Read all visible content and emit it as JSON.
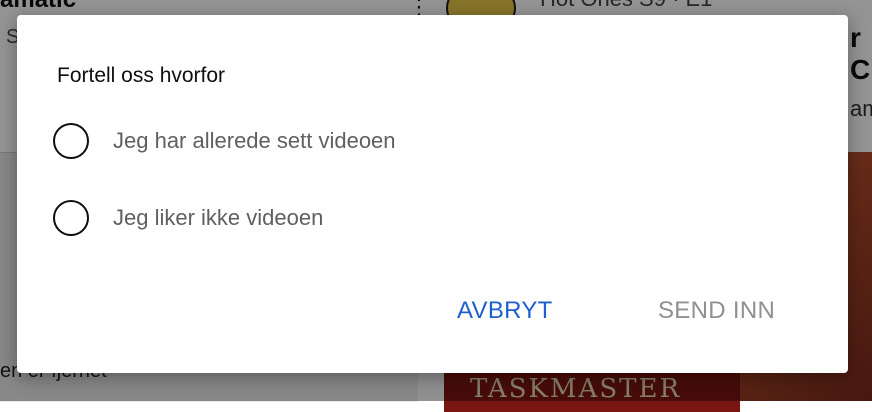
{
  "background": {
    "title_fragment": "amatic",
    "s_fragment": "S",
    "channel_fragment": "Hot Ones   S9 · E1",
    "right_fragment_c": "r C",
    "right_fragment_am": "am",
    "removed_fragment": "en er fjernet",
    "thumbnail_text": "TASKMASTER"
  },
  "dialog": {
    "title": "Fortell oss hvorfor",
    "options": [
      {
        "label": "Jeg har allerede sett videoen",
        "selected": false
      },
      {
        "label": "Jeg liker ikke videoen",
        "selected": false
      }
    ],
    "cancel_label": "AVBRYT",
    "submit_label": "SEND INN"
  },
  "colors": {
    "accent": "#1e5fcf",
    "disabled": "#909090"
  }
}
